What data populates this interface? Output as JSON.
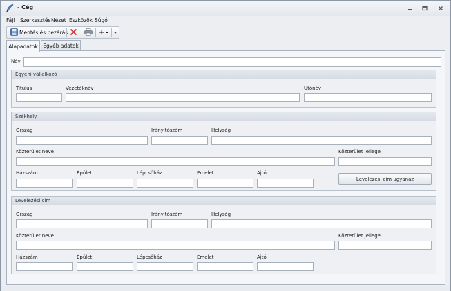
{
  "window": {
    "title": "- Cég",
    "icons": {
      "app": "feather-pen-icon",
      "minimize": "minimize-icon",
      "restore": "restore-icon",
      "close": "close-icon"
    }
  },
  "menu": [
    {
      "label": "Fájl"
    },
    {
      "label": "Szerkesztés"
    },
    {
      "label": "Nézet"
    },
    {
      "label": "Eszközök"
    },
    {
      "label": "Súgó"
    }
  ],
  "toolbar": {
    "save_close_label": "Mentés és bezárás",
    "icons": [
      "save-icon",
      "delete-icon",
      "print-icon",
      "add-icon",
      "remove-icon",
      "dropdown-icon"
    ],
    "add_symbol": "+",
    "remove_symbol": "-"
  },
  "tabs": [
    {
      "label": "Alapadatok",
      "active": true
    },
    {
      "label": "Egyéb adatok",
      "active": false
    }
  ],
  "form": {
    "name_label": "Név",
    "name_value": "",
    "sole_trader": {
      "title": "Egyéni vállalkozó",
      "title_label": "Titulus",
      "surname_label": "Vezetéknév",
      "firstname_label": "Utónév"
    },
    "headquarters": {
      "title": "Székhely",
      "country_label": "Ország",
      "zip_label": "Irányítószám",
      "city_label": "Helység",
      "street_label": "Közterület neve",
      "street_type_label": "Közterület jellege",
      "house_no_label": "Házszám",
      "building_label": "Épület",
      "staircase_label": "Lépcsőház",
      "floor_label": "Emelet",
      "door_label": "Ajtó",
      "same_address_button": "Levelezési cím ugyanaz"
    },
    "mailing": {
      "title": "Levelezési cím",
      "country_label": "Ország",
      "zip_label": "Irányítószám",
      "city_label": "Helység",
      "street_label": "Közterület neve",
      "street_type_label": "Közterület jellege",
      "house_no_label": "Házszám",
      "building_label": "Épület",
      "staircase_label": "Lépcsőház",
      "floor_label": "Emelet",
      "door_label": "Ajtó"
    }
  },
  "colors": {
    "accent_red": "#d0312d",
    "save_blue": "#3b6fb6",
    "frame": "#a9b3c0"
  }
}
